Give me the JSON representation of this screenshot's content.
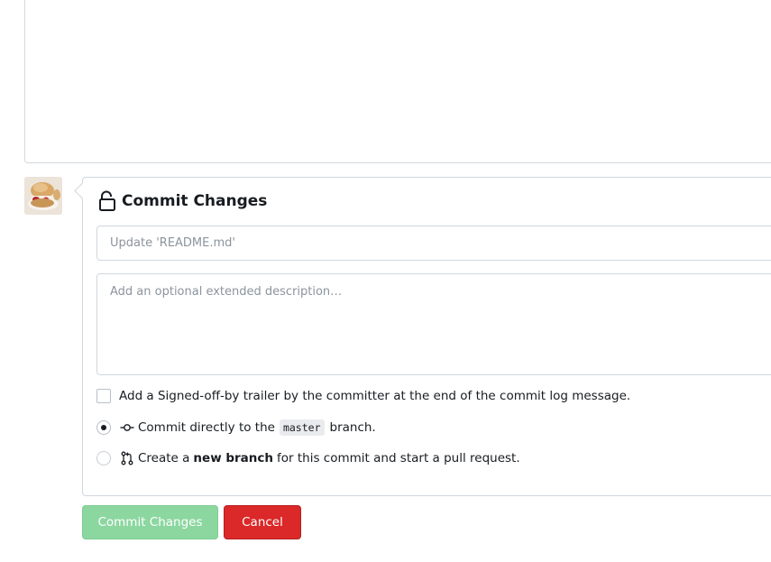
{
  "editor": {},
  "commit_form": {
    "title": "Commit Changes",
    "summary_placeholder": "Update 'README.md'",
    "summary_value": "",
    "description_placeholder": "Add an optional extended description…",
    "signoff_label": "Add a Signed-off-by trailer by the committer at the end of the commit log message.",
    "signoff_checked": false,
    "direct_option": {
      "prefix": "Commit directly to the",
      "branch": "master",
      "suffix": "branch.",
      "selected": true
    },
    "new_branch_option": {
      "prefix": "Create a",
      "bold": "new branch",
      "suffix": "for this commit and start a pull request.",
      "selected": false
    },
    "commit_button_label": "Commit Changes",
    "cancel_button_label": "Cancel"
  },
  "icons": {
    "panel_icon": "unlock-icon",
    "direct_icon": "git-commit-icon",
    "new_branch_icon": "git-pull-request-icon"
  },
  "colors": {
    "commit_button_bg": "#8cd7a0",
    "cancel_button_bg": "#db2828",
    "border": "#d0d7de"
  }
}
